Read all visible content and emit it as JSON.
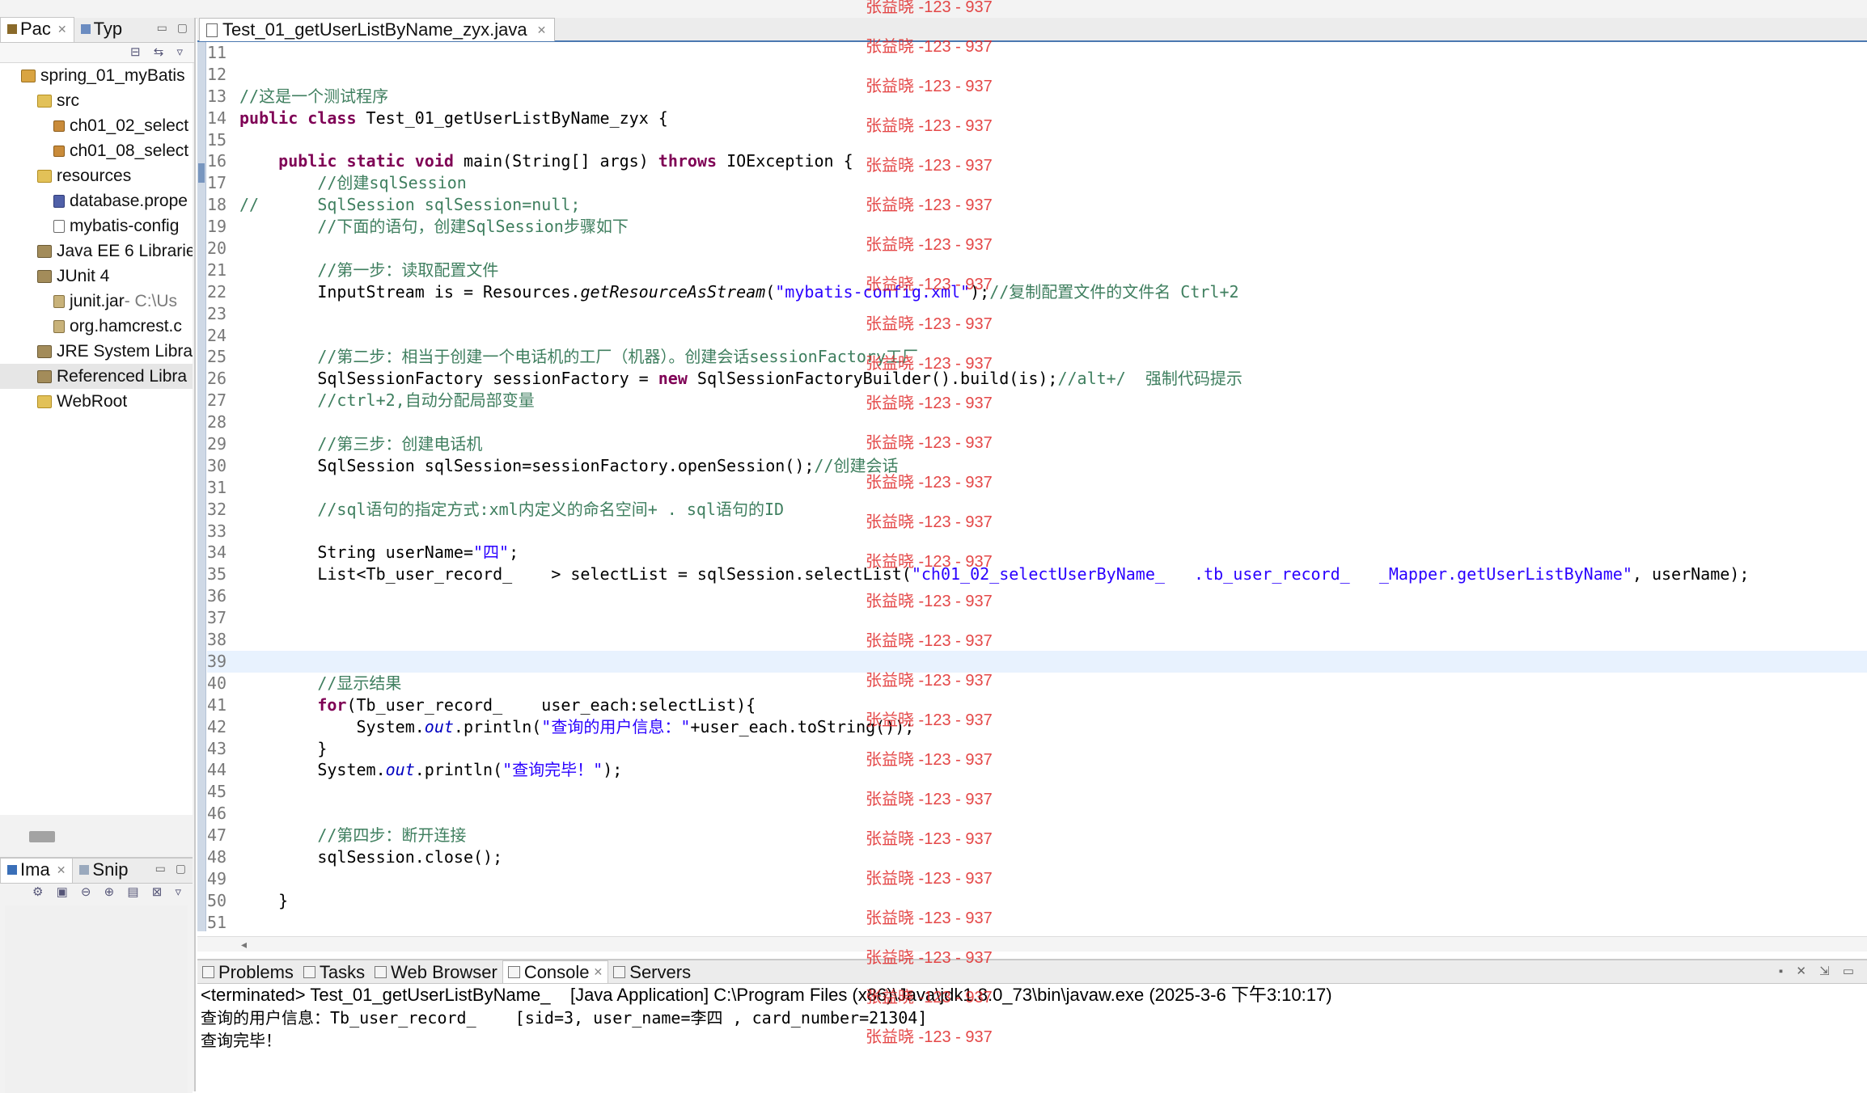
{
  "left_tabs": [
    {
      "label": "Pac",
      "active": true
    },
    {
      "label": "Typ",
      "active": false
    }
  ],
  "tree": [
    {
      "label": "spring_01_myBatis",
      "depth": 0,
      "icon": "project-icon",
      "kind": "proj"
    },
    {
      "label": "src",
      "depth": 1,
      "icon": "source-folder-icon",
      "kind": "folder"
    },
    {
      "label": "ch01_02_select",
      "depth": 2,
      "icon": "package-icon",
      "kind": "pkg"
    },
    {
      "label": "ch01_08_select",
      "depth": 2,
      "icon": "package-icon",
      "kind": "pkg"
    },
    {
      "label": "resources",
      "depth": 1,
      "icon": "source-folder-icon",
      "kind": "folder"
    },
    {
      "label": "database.prope",
      "depth": 2,
      "icon": "properties-file-icon",
      "kind": "file"
    },
    {
      "label": "mybatis-config",
      "depth": 2,
      "icon": "xml-file-icon",
      "kind": "xml"
    },
    {
      "label": "Java EE 6 Librarie",
      "depth": 1,
      "icon": "library-icon",
      "kind": "lib"
    },
    {
      "label": "JUnit 4",
      "depth": 1,
      "icon": "library-icon",
      "kind": "lib"
    },
    {
      "label": "junit.jar",
      "suffix": " - C:\\Us",
      "depth": 2,
      "icon": "jar-icon",
      "kind": "jar"
    },
    {
      "label": "org.hamcrest.c",
      "depth": 2,
      "icon": "jar-icon",
      "kind": "jar"
    },
    {
      "label": "JRE System Libra",
      "depth": 1,
      "icon": "library-icon",
      "kind": "lib"
    },
    {
      "label": "Referenced Libra",
      "depth": 1,
      "icon": "library-icon",
      "kind": "lib",
      "selected": true
    },
    {
      "label": "WebRoot",
      "depth": 1,
      "icon": "folder-icon",
      "kind": "folder"
    }
  ],
  "bottom_left_tabs": [
    {
      "label": "Ima",
      "active": true
    },
    {
      "label": "Snip",
      "active": false
    }
  ],
  "editor_tab": {
    "label": "Test_01_getUserListByName_zyx.java"
  },
  "code_lines": [
    {
      "n": "11",
      "tokens": []
    },
    {
      "n": "12",
      "tokens": []
    },
    {
      "n": "13",
      "tokens": [
        {
          "t": "//这是一个测试程序",
          "c": "cm"
        }
      ]
    },
    {
      "n": "14",
      "tokens": [
        {
          "t": "public class",
          "c": "kw"
        },
        {
          "t": " Test_01_getUserListByName_zyx {"
        }
      ]
    },
    {
      "n": "15",
      "tokens": []
    },
    {
      "n": "16",
      "tokens": [
        {
          "t": "    "
        },
        {
          "t": "public static void",
          "c": "kw"
        },
        {
          "t": " main(String[] args) "
        },
        {
          "t": "throws",
          "c": "kw"
        },
        {
          "t": " IOException {"
        }
      ]
    },
    {
      "n": "17",
      "tokens": [
        {
          "t": "        "
        },
        {
          "t": "//创建sqlSession",
          "c": "cm"
        }
      ]
    },
    {
      "n": "18",
      "tokens": [
        {
          "t": "//      SqlSession sqlSession=null;",
          "c": "cm"
        }
      ]
    },
    {
      "n": "19",
      "tokens": [
        {
          "t": "        "
        },
        {
          "t": "//下面的语句，创建SqlSession步骤如下",
          "c": "cm"
        }
      ]
    },
    {
      "n": "20",
      "tokens": []
    },
    {
      "n": "21",
      "tokens": [
        {
          "t": "        "
        },
        {
          "t": "//第一步：读取配置文件",
          "c": "cm"
        }
      ]
    },
    {
      "n": "22",
      "tokens": [
        {
          "t": "        InputStream is = Resources."
        },
        {
          "t": "getResourceAsStream",
          "c": "ital"
        },
        {
          "t": "("
        },
        {
          "t": "\"mybatis-config.xml\"",
          "c": "str"
        },
        {
          "t": ");"
        },
        {
          "t": "//复制配置文件的文件名 Ctrl+2",
          "c": "cm"
        }
      ]
    },
    {
      "n": "23",
      "tokens": []
    },
    {
      "n": "24",
      "tokens": []
    },
    {
      "n": "25",
      "tokens": [
        {
          "t": "        "
        },
        {
          "t": "//第二步：相当于创建一个电话机的工厂（机器）。创建会话sessionFactory工厂",
          "c": "cm"
        }
      ]
    },
    {
      "n": "26",
      "tokens": [
        {
          "t": "        SqlSessionFactory sessionFactory = "
        },
        {
          "t": "new",
          "c": "kw"
        },
        {
          "t": " SqlSessionFactoryBuilder().build(is);"
        },
        {
          "t": "//alt+/  强制代码提示",
          "c": "cm"
        }
      ]
    },
    {
      "n": "27",
      "tokens": [
        {
          "t": "        "
        },
        {
          "t": "//ctrl+2,自动分配局部变量",
          "c": "cm"
        }
      ]
    },
    {
      "n": "28",
      "tokens": []
    },
    {
      "n": "29",
      "tokens": [
        {
          "t": "        "
        },
        {
          "t": "//第三步：创建电话机",
          "c": "cm"
        }
      ]
    },
    {
      "n": "30",
      "tokens": [
        {
          "t": "        SqlSession sqlSession=sessionFactory.openSession();"
        },
        {
          "t": "//创建会话",
          "c": "cm"
        }
      ]
    },
    {
      "n": "31",
      "tokens": []
    },
    {
      "n": "32",
      "tokens": [
        {
          "t": "        "
        },
        {
          "t": "//sql语句的指定方式:xml内定义的命名空间+ . sql语句的ID",
          "c": "cm"
        }
      ]
    },
    {
      "n": "33",
      "tokens": []
    },
    {
      "n": "34",
      "tokens": [
        {
          "t": "        String userName="
        },
        {
          "t": "\"四\"",
          "c": "str"
        },
        {
          "t": ";"
        }
      ]
    },
    {
      "n": "35",
      "tokens": [
        {
          "t": "        List<Tb_user_record_    > selectList = sqlSession.selectList("
        },
        {
          "t": "\"ch01_02_selectUserByName_   .tb_user_record_   _Mapper.getUserListByName\"",
          "c": "str"
        },
        {
          "t": ", userName);"
        }
      ]
    },
    {
      "n": "36",
      "tokens": []
    },
    {
      "n": "37",
      "tokens": []
    },
    {
      "n": "38",
      "tokens": []
    },
    {
      "n": "39",
      "tokens": [],
      "highlight": true
    },
    {
      "n": "40",
      "tokens": [
        {
          "t": "        "
        },
        {
          "t": "//显示结果",
          "c": "cm"
        }
      ]
    },
    {
      "n": "41",
      "tokens": [
        {
          "t": "        "
        },
        {
          "t": "for",
          "c": "kw"
        },
        {
          "t": "(Tb_user_record_    user_each:selectList){"
        }
      ]
    },
    {
      "n": "42",
      "tokens": [
        {
          "t": "            System."
        },
        {
          "t": "out",
          "c": "fld"
        },
        {
          "t": ".println("
        },
        {
          "t": "\"查询的用户信息：\"",
          "c": "str"
        },
        {
          "t": "+user_each.toString());"
        }
      ]
    },
    {
      "n": "43",
      "tokens": [
        {
          "t": "        }"
        }
      ]
    },
    {
      "n": "44",
      "tokens": [
        {
          "t": "        System."
        },
        {
          "t": "out",
          "c": "fld"
        },
        {
          "t": ".println("
        },
        {
          "t": "\"查询完毕！\"",
          "c": "str"
        },
        {
          "t": ");"
        }
      ]
    },
    {
      "n": "45",
      "tokens": []
    },
    {
      "n": "46",
      "tokens": []
    },
    {
      "n": "47",
      "tokens": [
        {
          "t": "        "
        },
        {
          "t": "//第四步：断开连接",
          "c": "cm"
        }
      ]
    },
    {
      "n": "48",
      "tokens": [
        {
          "t": "        sqlSession.close();"
        }
      ]
    },
    {
      "n": "49",
      "tokens": []
    },
    {
      "n": "50",
      "tokens": [
        {
          "t": "    }"
        }
      ]
    },
    {
      "n": "51",
      "tokens": []
    }
  ],
  "console_tabs": [
    {
      "label": "Problems",
      "active": false
    },
    {
      "label": "Tasks",
      "active": false
    },
    {
      "label": "Web Browser",
      "active": false
    },
    {
      "label": "Console",
      "active": true,
      "closable": true
    },
    {
      "label": "Servers",
      "active": false
    }
  ],
  "console": {
    "header": "<terminated> Test_01_getUserListByName_    [Java Application] C:\\Program Files (x86)\\Java\\jdk1.8.0_73\\bin\\javaw.exe (2025-3-6 下午3:10:17)",
    "lines": [
      "查询的用户信息：Tb_user_record_    [sid=3, user_name=李四 , card_number=21304]",
      "查询完毕！"
    ]
  },
  "watermark": {
    "text": "张益晓 -123 - 937",
    "color": "#e02828",
    "count": 27
  },
  "colors": {
    "keyword": "#7f0055",
    "comment": "#3f7f5f",
    "string": "#2a00ff",
    "field": "#0000c0",
    "current_line": "#e8f2fe",
    "tab_underline": "#4b78b0"
  }
}
